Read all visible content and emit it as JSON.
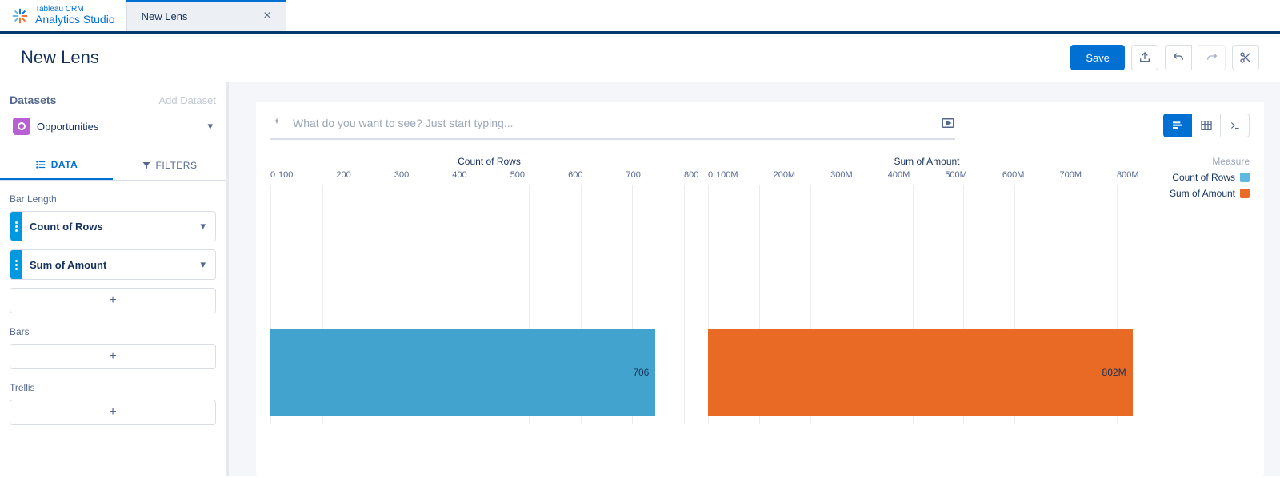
{
  "brand": {
    "sub": "Tableau CRM",
    "title": "Analytics Studio"
  },
  "tab": {
    "label": "New Lens"
  },
  "page": {
    "title": "New Lens",
    "save": "Save"
  },
  "sidebar": {
    "datasets_label": "Datasets",
    "add_dataset": "Add Dataset",
    "dataset_name": "Opportunities",
    "tab_data": "DATA",
    "tab_filters": "FILTERS",
    "section_bar_length": "Bar Length",
    "measure1": "Count of Rows",
    "measure2": "Sum of Amount",
    "section_bars": "Bars",
    "section_trellis": "Trellis"
  },
  "query": {
    "placeholder": "What do you want to see? Just start typing..."
  },
  "legend": {
    "title": "Measure",
    "item1": "Count of Rows",
    "item2": "Sum of Amount"
  },
  "chart_data": {
    "type": "bar",
    "orientation": "horizontal",
    "panels": [
      {
        "title": "Count of Rows",
        "xlim": [
          0,
          800
        ],
        "ticks": [
          "0",
          "100",
          "200",
          "300",
          "400",
          "500",
          "600",
          "700",
          "800"
        ],
        "value": 706,
        "value_label": "706",
        "color": "#43a3cf",
        "series_name": "Count of Rows"
      },
      {
        "title": "Sum of Amount",
        "xlim": [
          0,
          850000000
        ],
        "ticks": [
          "0",
          "100M",
          "200M",
          "300M",
          "400M",
          "500M",
          "600M",
          "700M",
          "800M"
        ],
        "value": 802000000,
        "value_label": "802M",
        "color": "#e96a25",
        "series_name": "Sum of Amount"
      }
    ]
  }
}
